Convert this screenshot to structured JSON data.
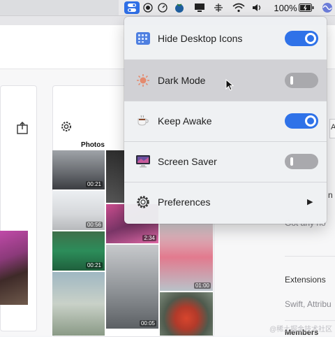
{
  "menubar": {
    "battery_percent": "100%"
  },
  "background": {
    "photos_title": "Photos",
    "photo_durations": [
      "00:21",
      "00:56",
      "00:21",
      "2:34",
      "01:00",
      "00:05"
    ],
    "right_column": {
      "top_letter": "A",
      "mid_letter": "n",
      "muted_line": "Got any no",
      "extensions_label": "Extensions",
      "extensions_value": "Swift, Attribu",
      "members_label": "Members"
    }
  },
  "menu": {
    "items": [
      {
        "label": "Hide Desktop Icons",
        "icon": "desktop-grid-icon",
        "toggle": "on"
      },
      {
        "label": "Dark Mode",
        "icon": "sun-icon",
        "toggle": "off"
      },
      {
        "label": "Keep Awake",
        "icon": "coffee-cup-icon",
        "toggle": "on"
      },
      {
        "label": "Screen Saver",
        "icon": "monitor-icon",
        "toggle": "off"
      },
      {
        "label": "Preferences",
        "icon": "gear-icon",
        "toggle": null
      }
    ]
  },
  "watermark": "@稀土掘金技术社区",
  "colors": {
    "accent": "#2f72e8",
    "toggle_off": "#a9a9ad",
    "menu_bg": "#eef0f3"
  }
}
